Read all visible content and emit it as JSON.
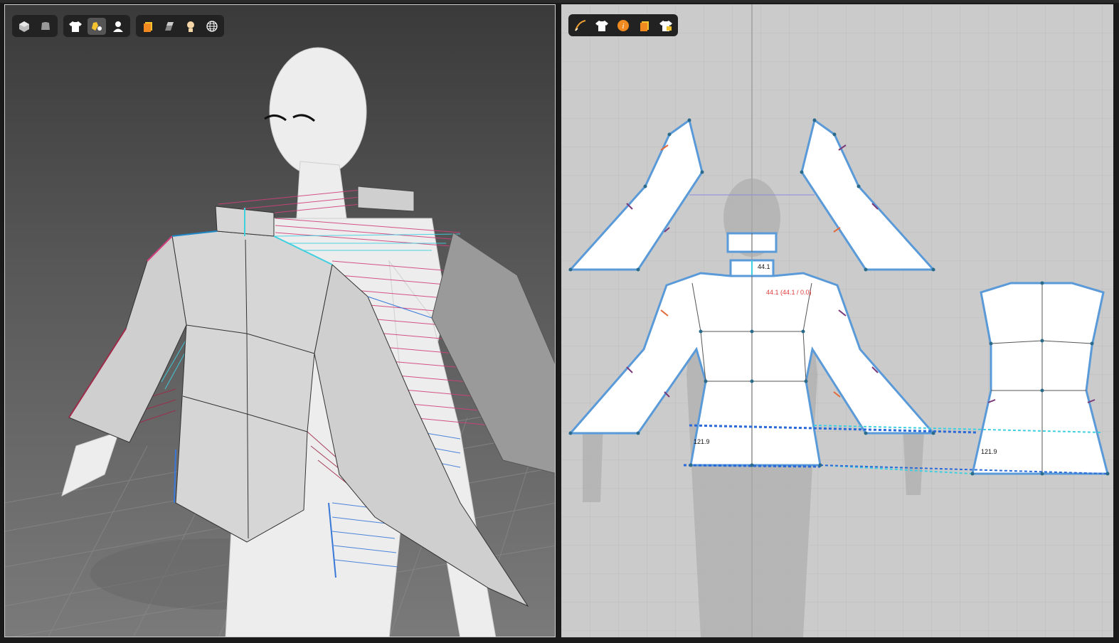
{
  "toolbar_3d": {
    "group1": [
      {
        "icon": "cube-solid-icon"
      },
      {
        "icon": "garment-cube-icon"
      }
    ],
    "group2": [
      {
        "icon": "shirt-icon"
      },
      {
        "icon": "fabric-pin-icon",
        "active": true
      },
      {
        "icon": "avatar-icon"
      }
    ],
    "group3": [
      {
        "icon": "texture-icon"
      },
      {
        "icon": "material-icon"
      },
      {
        "icon": "skin-icon"
      },
      {
        "icon": "globe-icon"
      }
    ]
  },
  "toolbar_2d": {
    "buttons": [
      {
        "icon": "pen-curve-icon"
      },
      {
        "icon": "shirt-icon"
      },
      {
        "icon": "info-icon"
      },
      {
        "icon": "texture-icon"
      },
      {
        "icon": "lock-shirt-icon"
      }
    ]
  },
  "measurements": {
    "collar": "44.1",
    "collar_detail": "44.1 (44.1 / 0.0)",
    "front_hem": "121.9",
    "back_hem": "121.9"
  },
  "colors": {
    "seam_blue": "#3a78d8",
    "seam_cyan": "#3fd0e0",
    "seam_magenta": "#d0407a",
    "seam_orange": "#e26a3a",
    "seam_purple": "#7a3a7a",
    "pattern_outline": "#5a9ad8"
  }
}
